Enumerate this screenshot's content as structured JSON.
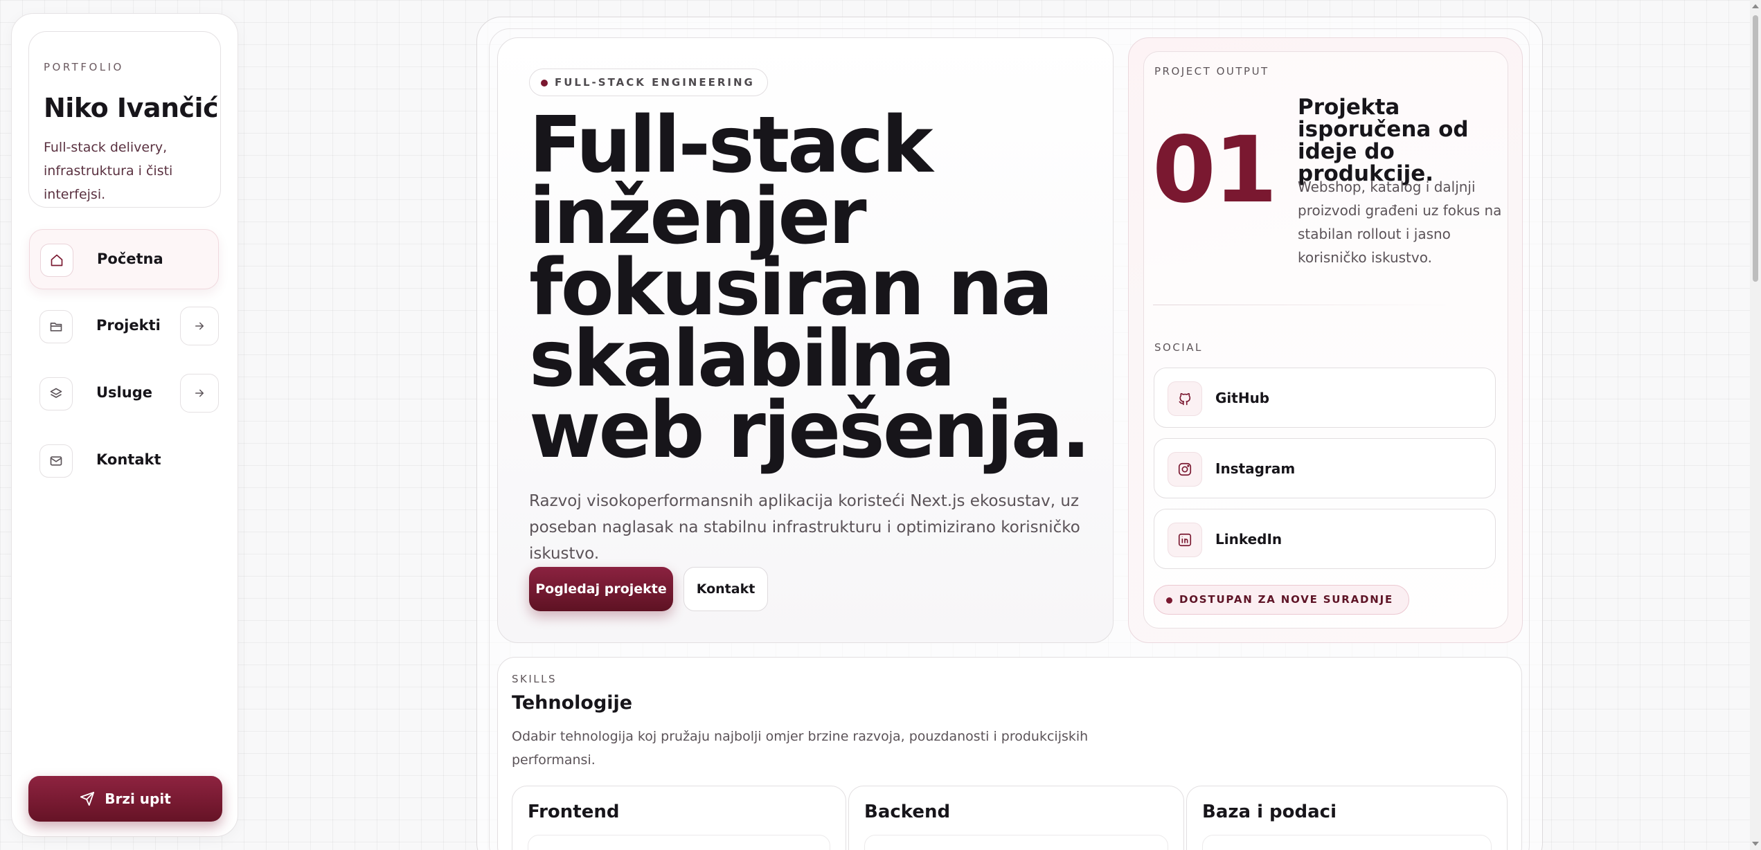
{
  "colors": {
    "accent": "#7a1830",
    "accent_dark": "#5e1223",
    "text": "#17151a",
    "muted": "#5b5358"
  },
  "sidebar": {
    "eyebrow": "PORTFOLIO",
    "name": "Niko Ivančić",
    "tagline": "Full-stack delivery, infrastruktura i čisti interfejsi.",
    "items": [
      {
        "label": "Početna",
        "icon": "home-icon",
        "active": true
      },
      {
        "label": "Projekti",
        "icon": "folder-icon",
        "active": false
      },
      {
        "label": "Usluge",
        "icon": "layers-icon",
        "active": false
      },
      {
        "label": "Kontakt",
        "icon": "mail-icon",
        "active": false
      }
    ],
    "quick_label": "Brzi upit"
  },
  "hero": {
    "badge": "FULL-STACK ENGINEERING",
    "headline": "Full-stack inženjer fokusiran na skalabilna web rješenja.",
    "lede": "Razvoj visokoperformansnih aplikacija koristeći Next.js ekosustav, uz poseban naglasak na stabilnu infrastrukturu i optimizirano korisničko iskustvo.",
    "primary_cta": "Pogledaj projekte",
    "secondary_cta": "Kontakt"
  },
  "project_output": {
    "eyebrow": "PROJECT OUTPUT",
    "count": "01",
    "title": "Projekta isporučena od ideje do produkcije.",
    "description": "Webshop, katalog i daljnji proizvodi građeni uz fokus na stabilan rollout i jasno korisničko iskustvo."
  },
  "social": {
    "eyebrow": "SOCIAL",
    "links": [
      {
        "label": "GitHub",
        "icon": "github-icon"
      },
      {
        "label": "Instagram",
        "icon": "instagram-icon"
      },
      {
        "label": "LinkedIn",
        "icon": "linkedin-icon"
      }
    ],
    "availability": "DOSTUPAN ZA NOVE SURADNJE"
  },
  "skills": {
    "eyebrow": "SKILLS",
    "title": "Tehnologije",
    "description": "Odabir tehnologija koj pružaju najbolji omjer brzine razvoja, pouzdanosti i produkcijskih performansi.",
    "cards": [
      {
        "title": "Frontend"
      },
      {
        "title": "Backend"
      },
      {
        "title": "Baza i podaci"
      }
    ]
  }
}
